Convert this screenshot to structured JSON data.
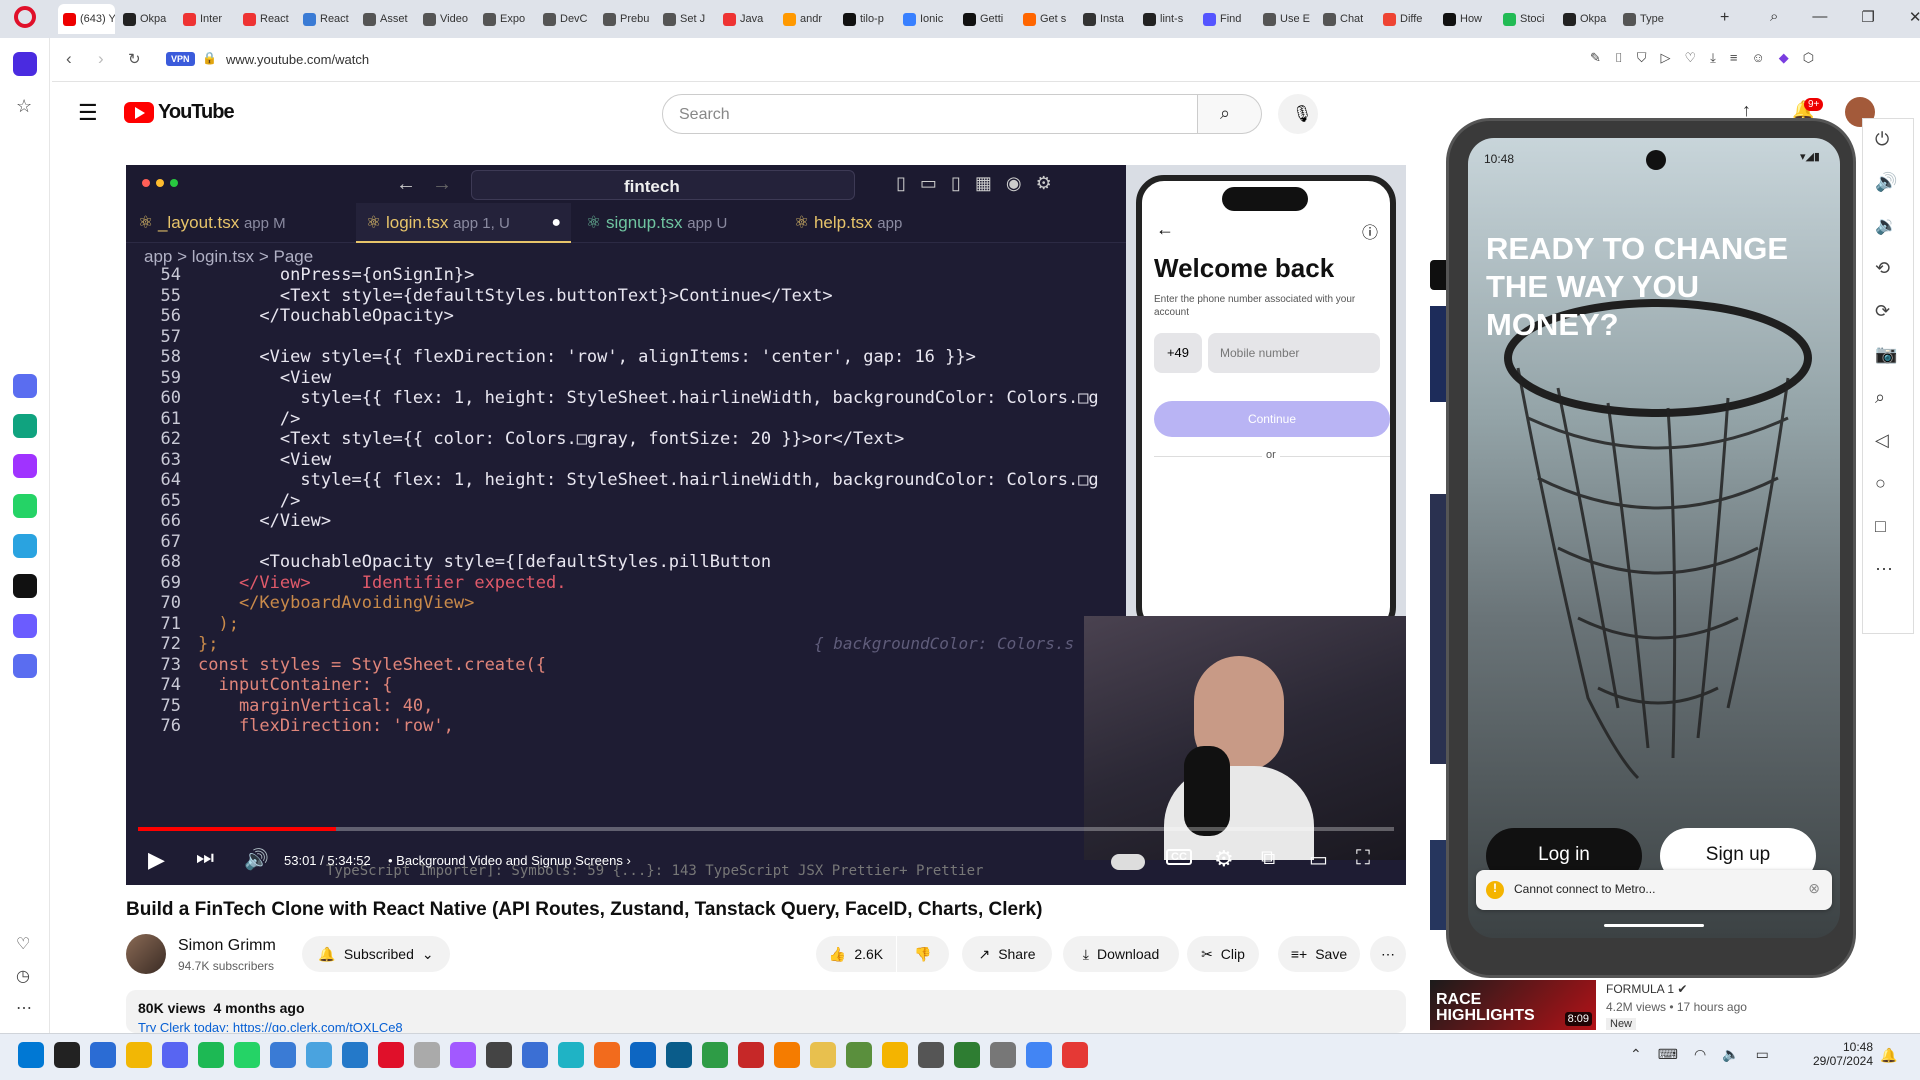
{
  "browser": {
    "tabs": [
      {
        "label": "(643) Y",
        "color": "#e00"
      },
      {
        "label": "Okpa",
        "color": "#222"
      },
      {
        "label": "Inter",
        "color": "#e33"
      },
      {
        "label": "React",
        "color": "#e33"
      },
      {
        "label": "React",
        "color": "#3a7bd5"
      },
      {
        "label": "Asset",
        "color": "#555"
      },
      {
        "label": "Video",
        "color": "#555"
      },
      {
        "label": "Expo",
        "color": "#555"
      },
      {
        "label": "DevC",
        "color": "#555"
      },
      {
        "label": "Prebu",
        "color": "#555"
      },
      {
        "label": "Set J",
        "color": "#555"
      },
      {
        "label": "Java",
        "color": "#e33"
      },
      {
        "label": "andr",
        "color": "#f90"
      },
      {
        "label": "tilo-p",
        "color": "#111"
      },
      {
        "label": "Ionic",
        "color": "#3880ff"
      },
      {
        "label": "Getti",
        "color": "#111"
      },
      {
        "label": "Get s",
        "color": "#f60"
      },
      {
        "label": "Insta",
        "color": "#333"
      },
      {
        "label": "lint-s",
        "color": "#222"
      },
      {
        "label": "Find",
        "color": "#55f"
      },
      {
        "label": "Use E",
        "color": "#555"
      },
      {
        "label": "Chat",
        "color": "#555"
      },
      {
        "label": "Diffe",
        "color": "#e43"
      },
      {
        "label": "How",
        "color": "#111"
      },
      {
        "label": "Stoci",
        "color": "#2b5"
      },
      {
        "label": "Okpa",
        "color": "#222"
      },
      {
        "label": "Type",
        "color": "#555"
      }
    ],
    "vpn_label": "VPN",
    "url": "www.youtube.com/watch"
  },
  "youtube": {
    "logo_text": "YouTube",
    "search_placeholder": "Search",
    "notif_badge": "9+",
    "video_title": "Build a FinTech Clone with React Native (API Routes, Zustand, Tanstack Query, FaceID, Charts, Clerk)",
    "channel_name": "Simon Grimm",
    "subscribers": "94.7K subscribers",
    "subscribe_label": "Subscribed",
    "like_count": "2.6K",
    "share_label": "Share",
    "download_label": "Download",
    "clip_label": "Clip",
    "save_label": "Save",
    "views": "80K views",
    "age": "4 months ago",
    "description_line": "Try Clerk today: https://go.clerk.com/tOXLCe8",
    "time_current": "53:01",
    "time_total": "5:34:52",
    "chapter": "Background Video and Signup Screens",
    "progress_fraction": 0.158,
    "rec": {
      "channel": "FORMULA 1",
      "meta": "4.2M views • 17 hours ago",
      "badge": "New",
      "duration": "8:09",
      "thumb_text": "RACE HIGHLIGHTS"
    }
  },
  "editor": {
    "search": "fintech",
    "tabs": [
      {
        "name": "_layout.tsx",
        "suffix": "app M"
      },
      {
        "name": "login.tsx",
        "suffix": "app 1, U"
      },
      {
        "name": "signup.tsx",
        "suffix": "app U"
      },
      {
        "name": "help.tsx",
        "suffix": "app"
      }
    ],
    "breadcrumb": "app  >  login.tsx  >  Page",
    "lines": [
      {
        "n": "54",
        "t": "        onPress={onSignIn}>"
      },
      {
        "n": "55",
        "t": "        <Text style={defaultStyles.buttonText}>Continue</Text>"
      },
      {
        "n": "56",
        "t": "      </TouchableOpacity>"
      },
      {
        "n": "57",
        "t": ""
      },
      {
        "n": "58",
        "t": "      <View style={{ flexDirection: 'row', alignItems: 'center', gap: 16 }}>"
      },
      {
        "n": "59",
        "t": "        <View"
      },
      {
        "n": "60",
        "t": "          style={{ flex: 1, height: StyleSheet.hairlineWidth, backgroundColor: Colors.□g"
      },
      {
        "n": "61",
        "t": "        />"
      },
      {
        "n": "62",
        "t": "        <Text style={{ color: Colors.□gray, fontSize: 20 }}>or</Text>"
      },
      {
        "n": "63",
        "t": "        <View"
      },
      {
        "n": "64",
        "t": "          style={{ flex: 1, height: StyleSheet.hairlineWidth, backgroundColor: Colors.□g"
      },
      {
        "n": "65",
        "t": "        />"
      },
      {
        "n": "66",
        "t": "      </View>"
      },
      {
        "n": "67",
        "t": ""
      },
      {
        "n": "68",
        "t": "      <TouchableOpacity style={[defaultStyles.pillButton"
      },
      {
        "n": "69",
        "t": "    </View>     Identifier expected."
      },
      {
        "n": "70",
        "t": "    </KeyboardAvoidingView>"
      },
      {
        "n": "71",
        "t": "  );"
      },
      {
        "n": "72",
        "t": "};"
      },
      {
        "n": "73",
        "t": "const styles = StyleSheet.create({"
      },
      {
        "n": "74",
        "t": "  inputContainer: {"
      },
      {
        "n": "75",
        "t": "    marginVertical: 40,"
      },
      {
        "n": "76",
        "t": "    flexDirection: 'row',"
      }
    ],
    "ghost_hint": "{ backgroundColor: Colors.s",
    "statusbar": "TypeScript Importer]: Symbols: 59   {...}: 143       TypeScript JSX      Prettier+    Prettier"
  },
  "sim_in_video": {
    "title": "Welcome back",
    "subtitle": "Enter the phone number associated with your account",
    "country_code": "+49",
    "mobile_placeholder": "Mobile number",
    "continue": "Continue",
    "or": "or"
  },
  "phone": {
    "time": "10:48",
    "headline": "READY TO CHANGE THE WAY YOU MONEY?",
    "login": "Log in",
    "signup": "Sign up",
    "toast": "Cannot connect to Metro..."
  },
  "taskbar": {
    "time": "10:48",
    "date": "29/07/2024"
  }
}
